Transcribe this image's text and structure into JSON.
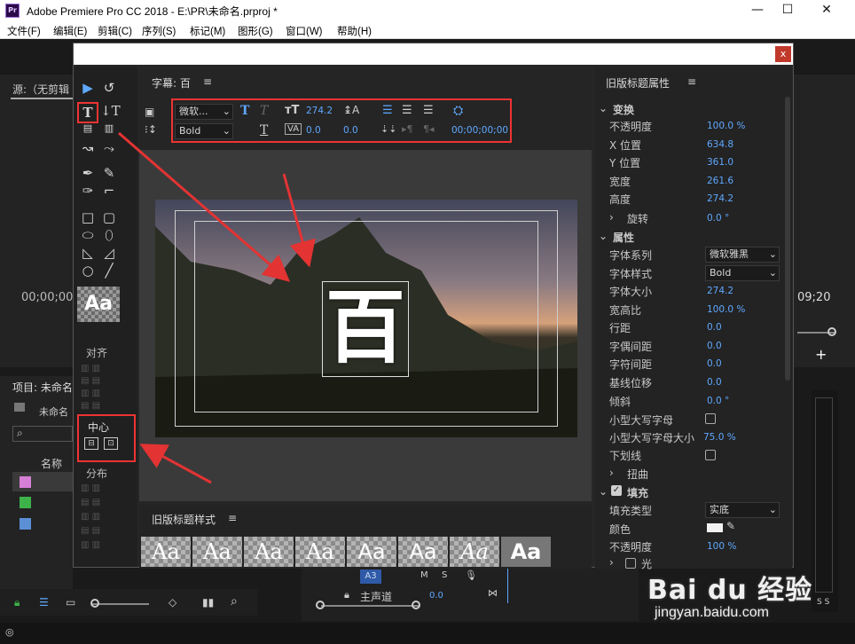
{
  "window": {
    "title": "Adobe Premiere Pro CC 2018 - E:\\PR\\未命名.prproj *",
    "app_icon": "Pr",
    "minimize": "—",
    "maximize": "☐",
    "close": "✕"
  },
  "menu": [
    "文件(F)",
    "编辑(E)",
    "剪辑(C)",
    "序列(S)",
    "标记(M)",
    "图形(G)",
    "窗口(W)",
    "帮助(H)"
  ],
  "bg": {
    "source_label": "源:（无剪辑",
    "timecode_left": "00;00;00",
    "timecode_right": "09;20",
    "project_label": "项目: 未命名",
    "project_file": "未命名",
    "name_col": "名称",
    "plus": "+",
    "track_a3": "A3",
    "track_m": "M",
    "track_s": "S",
    "master": "主声道",
    "master_val": "0.0",
    "ss": "S S"
  },
  "dialog": {
    "close": "x",
    "caption_label": "字幕: 百",
    "toolbar": {
      "font_family": "微软...",
      "font_style": "Bold",
      "font_size": "274.2",
      "tracking": "0.0",
      "kerning": "0.0",
      "leading": "0.0",
      "timecode": "00;00;00;00"
    },
    "big_text": "百",
    "sample_glyph": "Aa",
    "align_label": "对齐",
    "center_label": "中心",
    "distribute_label": "分布",
    "styles_label": "旧版标题样式",
    "styles": [
      "Aa",
      "Aa",
      "Aa",
      "Aa",
      "Aa",
      "Aa",
      "Aa",
      "Aa"
    ]
  },
  "properties": {
    "header": "旧版标题属性",
    "transform": "变换",
    "rows": [
      {
        "label": "不透明度",
        "value": "100.0 %"
      },
      {
        "label": "X 位置",
        "value": "634.8"
      },
      {
        "label": "Y 位置",
        "value": "361.0"
      },
      {
        "label": "宽度",
        "value": "261.6"
      },
      {
        "label": "高度",
        "value": "274.2"
      }
    ],
    "rotation": {
      "label": "旋转",
      "value": "0.0 °"
    },
    "attributes": "属性",
    "font_family": {
      "label": "字体系列",
      "value": "微软雅黑"
    },
    "font_style": {
      "label": "字体样式",
      "value": "Bold"
    },
    "attr_rows": [
      {
        "label": "字体大小",
        "value": "274.2"
      },
      {
        "label": "宽高比",
        "value": "100.0 %"
      },
      {
        "label": "行距",
        "value": "0.0"
      },
      {
        "label": "字偶间距",
        "value": "0.0"
      },
      {
        "label": "字符间距",
        "value": "0.0"
      },
      {
        "label": "基线位移",
        "value": "0.0"
      },
      {
        "label": "倾斜",
        "value": "0.0 °"
      }
    ],
    "small_caps": "小型大写字母",
    "small_caps_size": {
      "label": "小型大写字母大小",
      "value": "75.0 %"
    },
    "underline": "下划线",
    "distort": "扭曲",
    "fill": "填充",
    "fill_type": {
      "label": "填充类型",
      "value": "实底"
    },
    "color": "颜色",
    "opacity": {
      "label": "不透明度",
      "value": "100 %"
    },
    "sheen": "光"
  },
  "watermark": {
    "logo": "Bai du 经验",
    "url": "jingyan.baidu.com"
  },
  "colors": {
    "accent_blue": "#5fa8ff",
    "annotation_red": "#e33333",
    "swatch_pink": "#d67fd6",
    "swatch_green": "#3db34a",
    "swatch_blue": "#5b8fd6"
  }
}
